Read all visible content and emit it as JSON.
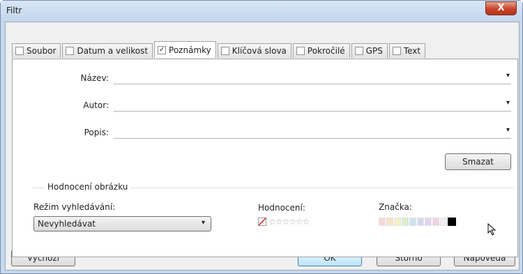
{
  "window": {
    "title": "Filtr",
    "close_label": "X"
  },
  "tabs": [
    {
      "label": "Soubor",
      "checked": false
    },
    {
      "label": "Datum a velikost",
      "checked": false
    },
    {
      "label": "Poznámky",
      "checked": true
    },
    {
      "label": "Klíčová slova",
      "checked": false
    },
    {
      "label": "Pokročilé",
      "checked": false
    },
    {
      "label": "GPS",
      "checked": false
    },
    {
      "label": "Text",
      "checked": false
    }
  ],
  "fields": {
    "name_label": "Název:",
    "name_value": "",
    "author_label": "Autor:",
    "author_value": "",
    "description_label": "Popis:",
    "description_value": "",
    "clear_button": "Smazat"
  },
  "rating_group": {
    "title": "Hodnocení obrázku",
    "search_mode_label": "Režim vyhledávání:",
    "search_mode_value": "Nevyhledávat",
    "rating_label": "Hodnocení:",
    "stars": "☆☆☆☆☆☆",
    "tag_label": "Značka:",
    "tag_colors": [
      "#f3d9d9",
      "#f6e3c6",
      "#f3f2c6",
      "#d9efcf",
      "#cfe3ef",
      "#d3d7f0",
      "#e4d3ef",
      "#f0d3e4",
      "#eeeeee",
      "#000000"
    ]
  },
  "footer": {
    "default_button": "Výchozí",
    "ok_button": "OK",
    "cancel_button": "Storno",
    "help_button": "Nápověda"
  },
  "icons": {
    "combo_arrow": "▾",
    "check": "✓"
  }
}
